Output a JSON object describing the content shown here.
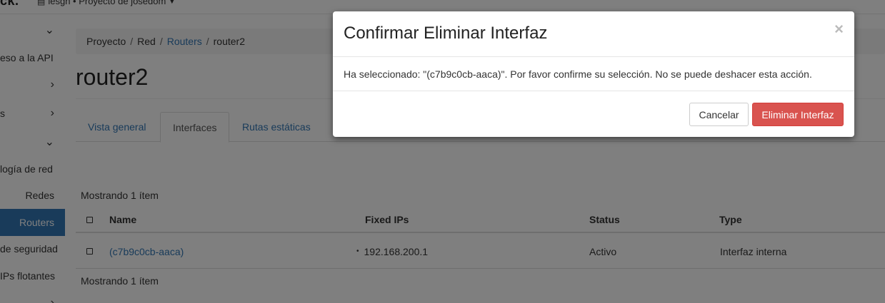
{
  "topbar": {
    "brand": "ck.",
    "project_selector": "lesgh • Proyecto de josedom"
  },
  "sidebar": {
    "items": [
      {
        "label": "",
        "icon": "chevron-down-icon"
      },
      {
        "label": "eso a la API"
      },
      {
        "label": "",
        "icon": "chevron-right-icon"
      },
      {
        "label": "s",
        "icon": "chevron-right-icon"
      },
      {
        "label": "",
        "icon": "chevron-down-icon"
      },
      {
        "label": "logía de red"
      },
      {
        "label": "Redes"
      },
      {
        "label": "Routers",
        "active": true
      },
      {
        "label": "de seguridad"
      },
      {
        "label": "IPs flotantes"
      },
      {
        "label": "",
        "icon": "chevron-right-icon"
      }
    ]
  },
  "breadcrumb": {
    "items": [
      "Proyecto",
      "Red",
      "Routers",
      "router2"
    ]
  },
  "page": {
    "title": "router2"
  },
  "tabs": [
    {
      "label": "Vista general"
    },
    {
      "label": "Interfaces",
      "active": true
    },
    {
      "label": "Rutas estáticas"
    }
  ],
  "table": {
    "count_top": "Mostrando 1 ítem",
    "count_bottom": "Mostrando 1 ítem",
    "columns": [
      "Name",
      "Fixed IPs",
      "Status",
      "Type"
    ],
    "rows": [
      {
        "name": "(c7b9c0cb-aaca)",
        "fixed_ips": "192.168.200.1",
        "status": "Activo",
        "type": "Interfaz interna"
      }
    ]
  },
  "modal": {
    "title": "Confirmar Eliminar Interfaz",
    "close_glyph": "×",
    "body": "Ha seleccionado: \"(c7b9c0cb-aaca)\". Por favor confirme su selección. No se puede deshacer esta acción.",
    "cancel_label": "Cancelar",
    "confirm_label": "Eliminar Interfaz"
  },
  "colors": {
    "accent": "#3277b5",
    "danger": "#d9534f",
    "backdrop": "rgba(0,0,0,0.5)"
  }
}
